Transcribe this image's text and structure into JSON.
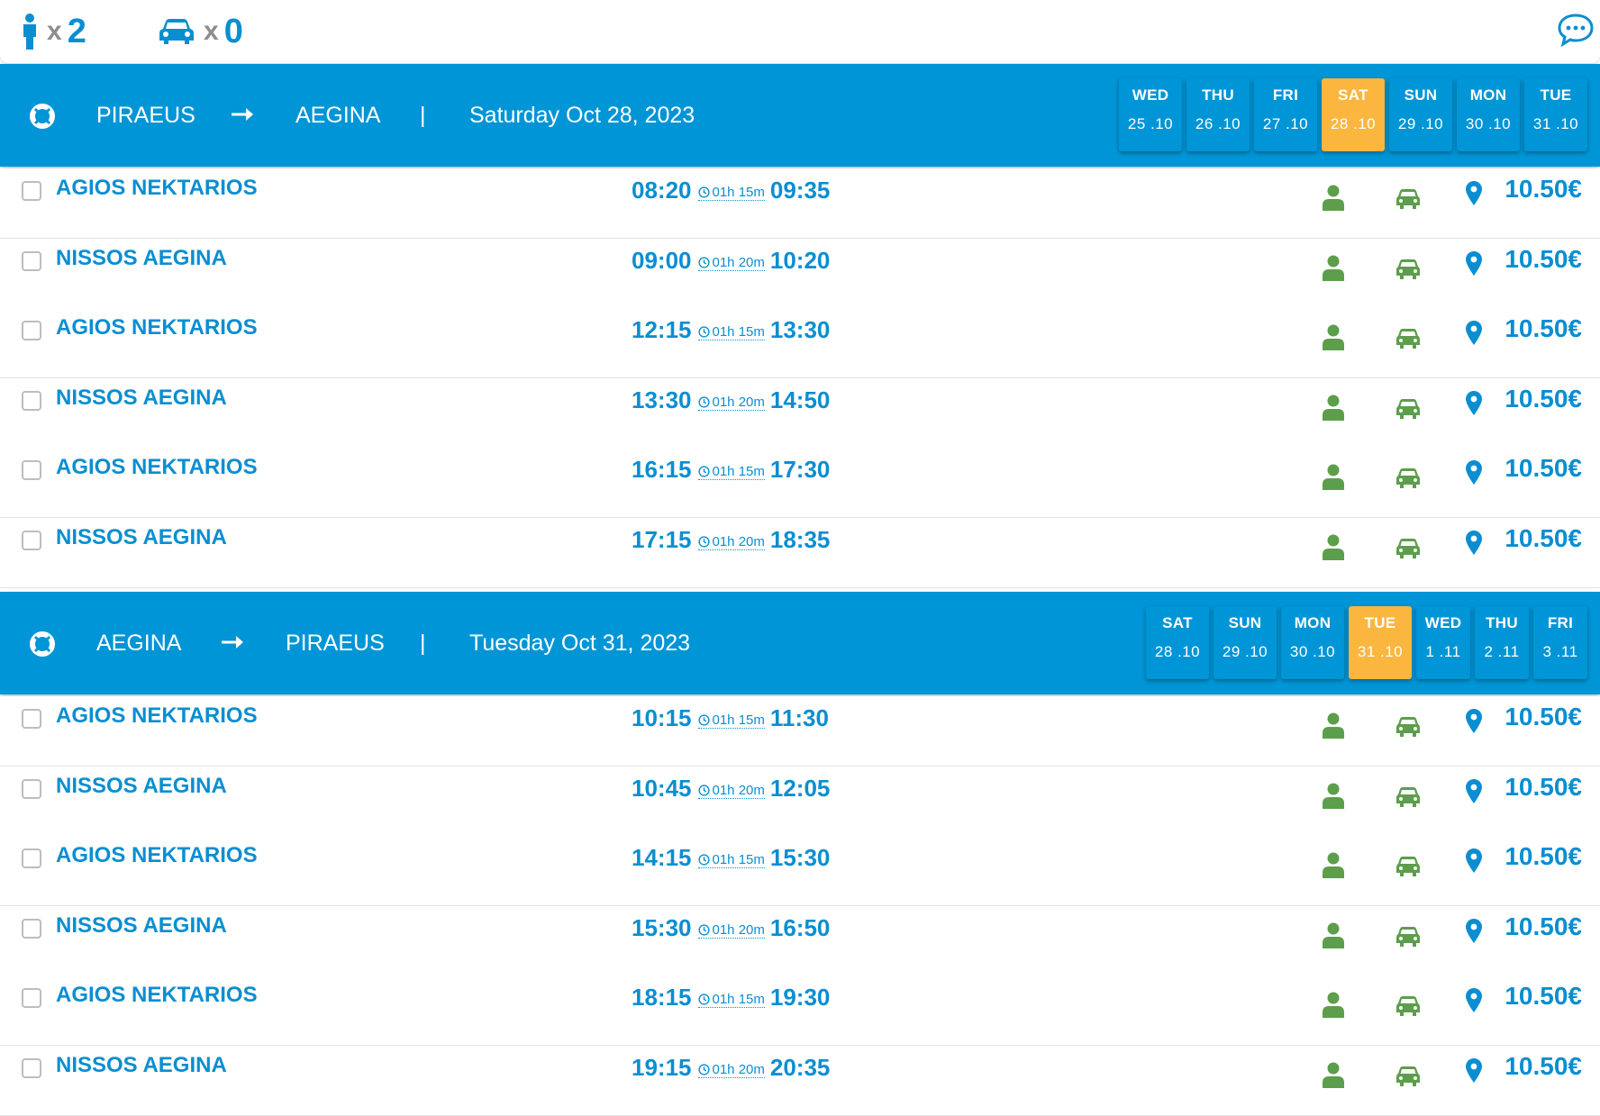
{
  "topbar": {
    "passenger_prefix": "x",
    "passenger_count": "2",
    "vehicle_prefix": "x",
    "vehicle_count": "0"
  },
  "colors": {
    "brand_blue": "#0095d6",
    "text_blue": "#0a8ed1",
    "active_day": "#fbb63f",
    "available_green": "#5c9e4b"
  },
  "icons": {
    "passenger": "person-icon",
    "vehicle": "car-icon",
    "chat": "chat-icon",
    "route": "lifebuoy-icon",
    "arrow": "arrow-right-icon",
    "duration": "clock-icon",
    "port": "map-pin-icon"
  },
  "sections": [
    {
      "from": "PIRAEUS",
      "to": "AEGINA",
      "separator": "|",
      "date_text": "Saturday Oct 28, 2023",
      "days": [
        {
          "name": "WED",
          "date": "25 .10",
          "active": false
        },
        {
          "name": "THU",
          "date": "26 .10",
          "active": false
        },
        {
          "name": "FRI",
          "date": "27 .10",
          "active": false
        },
        {
          "name": "SAT",
          "date": "28 .10",
          "active": true
        },
        {
          "name": "SUN",
          "date": "29 .10",
          "active": false
        },
        {
          "name": "MON",
          "date": "30 .10",
          "active": false
        },
        {
          "name": "TUE",
          "date": "31 .10",
          "active": false
        }
      ],
      "trips": [
        {
          "vessel": "AGIOS NEKTARIOS",
          "depart": "08:20",
          "duration": "01h 15m",
          "arrive": "09:35",
          "price": "10.50€"
        },
        {
          "vessel": "NISSOS AEGINA",
          "depart": "09:00",
          "duration": "01h 20m",
          "arrive": "10:20",
          "price": "10.50€"
        },
        {
          "vessel": "AGIOS NEKTARIOS",
          "depart": "12:15",
          "duration": "01h 15m",
          "arrive": "13:30",
          "price": "10.50€"
        },
        {
          "vessel": "NISSOS AEGINA",
          "depart": "13:30",
          "duration": "01h 20m",
          "arrive": "14:50",
          "price": "10.50€"
        },
        {
          "vessel": "AGIOS NEKTARIOS",
          "depart": "16:15",
          "duration": "01h 15m",
          "arrive": "17:30",
          "price": "10.50€"
        },
        {
          "vessel": "NISSOS AEGINA",
          "depart": "17:15",
          "duration": "01h 20m",
          "arrive": "18:35",
          "price": "10.50€"
        }
      ]
    },
    {
      "from": "AEGINA",
      "to": "PIRAEUS",
      "separator": "|",
      "date_text": "Tuesday Oct 31, 2023",
      "days": [
        {
          "name": "SAT",
          "date": "28 .10",
          "active": false
        },
        {
          "name": "SUN",
          "date": "29 .10",
          "active": false
        },
        {
          "name": "MON",
          "date": "30 .10",
          "active": false
        },
        {
          "name": "TUE",
          "date": "31 .10",
          "active": true
        },
        {
          "name": "WED",
          "date": "1 .11",
          "active": false
        },
        {
          "name": "THU",
          "date": "2 .11",
          "active": false
        },
        {
          "name": "FRI",
          "date": "3 .11",
          "active": false
        }
      ],
      "trips": [
        {
          "vessel": "AGIOS NEKTARIOS",
          "depart": "10:15",
          "duration": "01h 15m",
          "arrive": "11:30",
          "price": "10.50€"
        },
        {
          "vessel": "NISSOS AEGINA",
          "depart": "10:45",
          "duration": "01h 20m",
          "arrive": "12:05",
          "price": "10.50€"
        },
        {
          "vessel": "AGIOS NEKTARIOS",
          "depart": "14:15",
          "duration": "01h 15m",
          "arrive": "15:30",
          "price": "10.50€"
        },
        {
          "vessel": "NISSOS AEGINA",
          "depart": "15:30",
          "duration": "01h 20m",
          "arrive": "16:50",
          "price": "10.50€"
        },
        {
          "vessel": "AGIOS NEKTARIOS",
          "depart": "18:15",
          "duration": "01h 15m",
          "arrive": "19:30",
          "price": "10.50€"
        },
        {
          "vessel": "NISSOS AEGINA",
          "depart": "19:15",
          "duration": "01h 20m",
          "arrive": "20:35",
          "price": "10.50€"
        }
      ]
    }
  ]
}
